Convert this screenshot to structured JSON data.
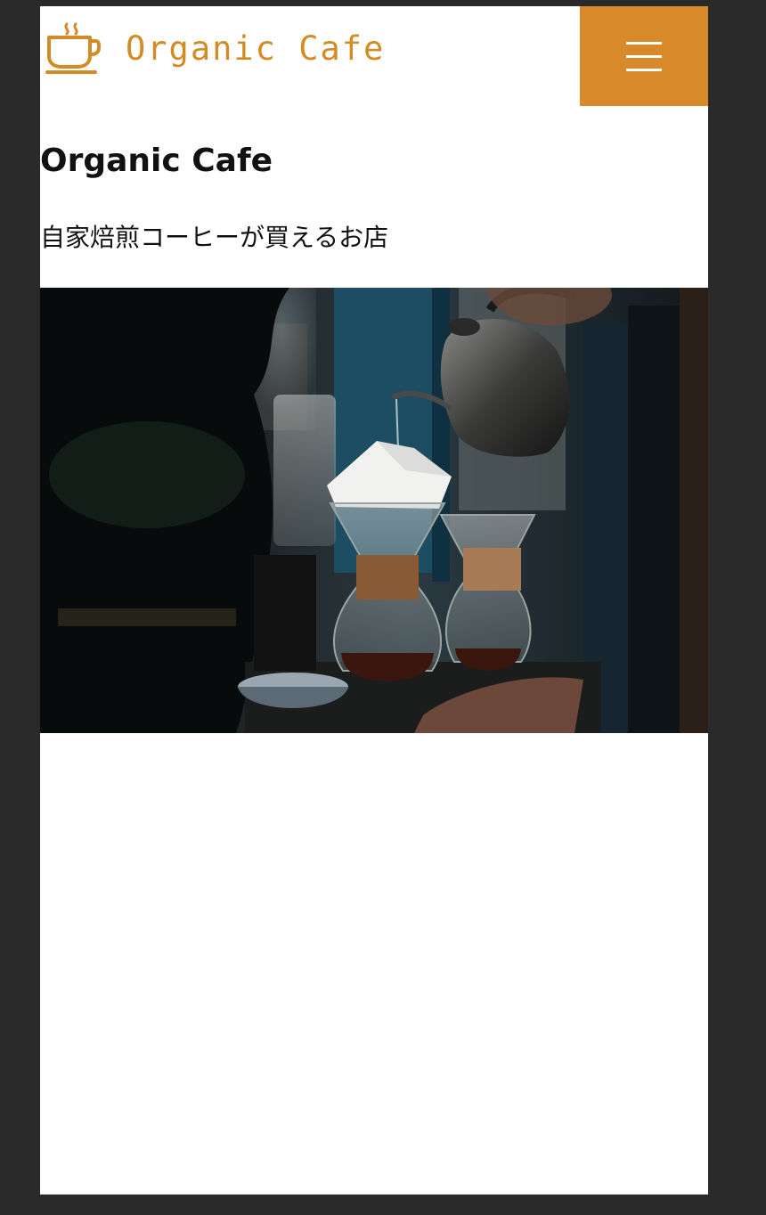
{
  "header": {
    "logo_text": "Organic Cafe",
    "logo_icon": "coffee-cup-icon",
    "menu_icon": "hamburger-menu-icon"
  },
  "main": {
    "title": "Organic Cafe",
    "tagline": "自家焙煎コーヒーが買えるお店"
  },
  "colors": {
    "accent": "#d8892a",
    "logo": "#d38c25",
    "page_background": "#2a2a2a",
    "content_background": "#ffffff"
  }
}
